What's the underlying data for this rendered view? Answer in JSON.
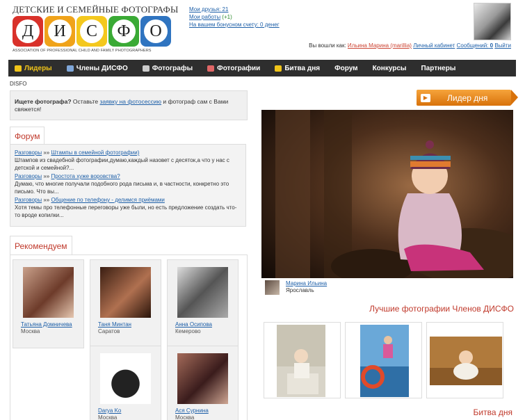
{
  "header": {
    "logo_title": "ДЕТСКИЕ И СЕМЕЙНЫЕ ФОТОГРАФЫ",
    "logo_letters": [
      {
        "char": "Д",
        "color": "#d9312a"
      },
      {
        "char": "И",
        "color": "#f0a31a"
      },
      {
        "char": "С",
        "color": "#f4c81d"
      },
      {
        "char": "Ф",
        "color": "#3aaa35"
      },
      {
        "char": "О",
        "color": "#2f74c0"
      }
    ],
    "logo_sub": "ASSOCIATION OF PROFESSIONAL CHILD AND FAMILY PHOTOGRAPHERS",
    "links": {
      "friends": "Мои друзья: 21",
      "works": "Мои работы",
      "works_plus": "(+1)",
      "bonus": "На вашем бонусном счету: 0 денег"
    },
    "login": {
      "prefix": "Вы вошли как:",
      "user": "Ильина Марина (marillia)",
      "cabinet": "Личный кабинет",
      "messages": "Сообщений:",
      "messages_count": "0",
      "logout": "Выйти"
    }
  },
  "nav": {
    "items": [
      {
        "label": "Лидеры",
        "icon": "crown-icon",
        "color": "#f0c419"
      },
      {
        "label": "Члены ДИСФО",
        "icon": "shield-icon",
        "color": "#7fa7d9"
      },
      {
        "label": "Фотографы",
        "icon": "camera-icon",
        "color": "#cccccc"
      },
      {
        "label": "Фотографии",
        "icon": "photos-icon",
        "color": "#e06666"
      },
      {
        "label": "Битва дня",
        "icon": "battle-icon",
        "color": "#f0c419"
      },
      {
        "label": "Форум",
        "icon": "",
        "color": ""
      },
      {
        "label": "Конкурсы",
        "icon": "",
        "color": ""
      },
      {
        "label": "Партнеры",
        "icon": "",
        "color": ""
      }
    ]
  },
  "breadcrumb": "DISFO",
  "search": {
    "bold": "Ищете фотографа?",
    "before": " Оставьте ",
    "link": "заявку на фотосессию",
    "after": " и фотограф сам с Вами свяжется!"
  },
  "forum": {
    "tab": "Форум",
    "entries": [
      {
        "section": "Разговоры",
        "sep": " »» ",
        "topic": "Штампы в семейной фотографии)",
        "text": "Штампов из свадебной фотографии,думаю,каждый назовет с десяток,а что у нас с детской и семейной?..."
      },
      {
        "section": "Разговоры",
        "sep": " »» ",
        "topic": "Простота хуже воровства?",
        "text": "Думаю, что многие получали подобного рода письма и, в частности, конкретно это письмо. Что вы..."
      },
      {
        "section": "Разговоры",
        "sep": " »» ",
        "topic": "Общение по телефону - делимся приёмами",
        "text": "Хотя темы про телефонные переговоры уже были, но есть предложение создать что-то вроде копилки..."
      }
    ]
  },
  "recommended": {
    "tab": "Рекомендуем",
    "people": [
      {
        "name": "Татьяна Домничева",
        "city": "Москва"
      },
      {
        "name": "Таня Минтан",
        "city": "Саратов"
      },
      {
        "name": "Анна Осипова",
        "city": "Кемерово"
      },
      {
        "name": "Darya Ko",
        "city": "Москва"
      },
      {
        "name": "Ася Сурнина",
        "city": "Москва"
      }
    ]
  },
  "leader": {
    "label": "Лидер дня",
    "author": "Марина Ильина",
    "city": "Ярославль"
  },
  "best": {
    "title": "Лучшие фотографии Членов ДИСФО"
  },
  "battle": {
    "title": "Битва дня"
  }
}
